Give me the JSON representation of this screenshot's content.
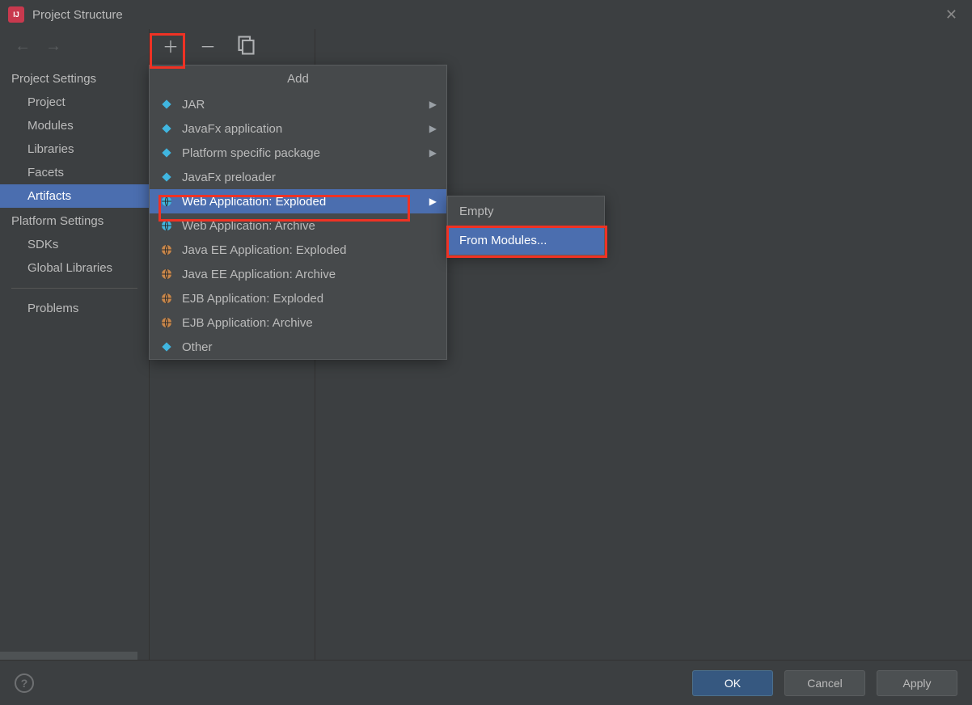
{
  "window": {
    "title": "Project Structure"
  },
  "sidebar": {
    "projectSettings": {
      "header": "Project Settings",
      "items": [
        "Project",
        "Modules",
        "Libraries",
        "Facets",
        "Artifacts"
      ]
    },
    "platformSettings": {
      "header": "Platform Settings",
      "items": [
        "SDKs",
        "Global Libraries"
      ]
    },
    "problems": "Problems",
    "selected": "Artifacts"
  },
  "popup": {
    "title": "Add",
    "items": [
      {
        "label": "JAR",
        "icon": "diamond",
        "submenu": true
      },
      {
        "label": "JavaFx application",
        "icon": "diamond",
        "submenu": true
      },
      {
        "label": "Platform specific package",
        "icon": "diamond",
        "submenu": true
      },
      {
        "label": "JavaFx preloader",
        "icon": "diamond",
        "submenu": false
      },
      {
        "label": "Web Application: Exploded",
        "icon": "globe",
        "submenu": true,
        "selected": true
      },
      {
        "label": "Web Application: Archive",
        "icon": "globe",
        "submenu": false
      },
      {
        "label": "Java EE Application: Exploded",
        "icon": "ear",
        "submenu": false
      },
      {
        "label": "Java EE Application: Archive",
        "icon": "ear",
        "submenu": false
      },
      {
        "label": "EJB Application: Exploded",
        "icon": "ejb",
        "submenu": false
      },
      {
        "label": "EJB Application: Archive",
        "icon": "ejb",
        "submenu": false
      },
      {
        "label": "Other",
        "icon": "diamond",
        "submenu": false
      }
    ]
  },
  "submenu": {
    "items": [
      {
        "label": "Empty",
        "selected": false
      },
      {
        "label": "From Modules...",
        "selected": true
      }
    ]
  },
  "footer": {
    "ok": "OK",
    "cancel": "Cancel",
    "apply": "Apply"
  }
}
